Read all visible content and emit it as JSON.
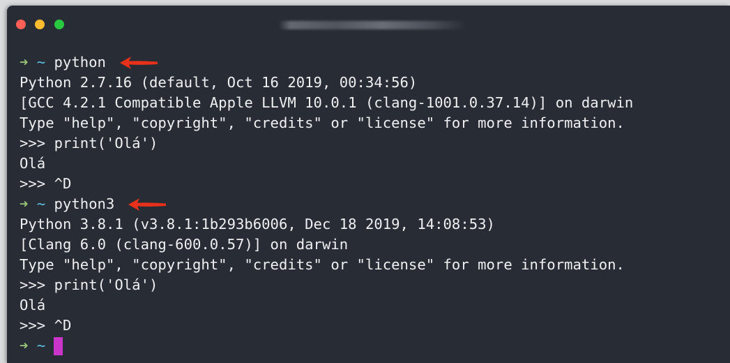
{
  "window": {
    "title": ""
  },
  "colors": {
    "background": "#282c34",
    "text": "#eef0f2",
    "prompt_arrow": "#98c379",
    "prompt_dir": "#5fc3e4",
    "cursor": "#c934c9",
    "annotation_arrow": "#e8311a"
  },
  "terminal": {
    "prompt_symbol": "➜",
    "prompt_dir": "~",
    "lines": [
      {
        "kind": "prompt",
        "command": "python",
        "annotated": true
      },
      {
        "kind": "output",
        "text": "Python 2.7.16 (default, Oct 16 2019, 00:34:56)"
      },
      {
        "kind": "output",
        "text": "[GCC 4.2.1 Compatible Apple LLVM 10.0.1 (clang-1001.0.37.14)] on darwin"
      },
      {
        "kind": "output",
        "text": "Type \"help\", \"copyright\", \"credits\" or \"license\" for more information."
      },
      {
        "kind": "output",
        "text": ">>> print('Olá')"
      },
      {
        "kind": "output",
        "text": "Olá"
      },
      {
        "kind": "output",
        "text": ">>> ^D"
      },
      {
        "kind": "prompt",
        "command": "python3",
        "annotated": true
      },
      {
        "kind": "output",
        "text": "Python 3.8.1 (v3.8.1:1b293b6006, Dec 18 2019, 14:08:53)"
      },
      {
        "kind": "output",
        "text": "[Clang 6.0 (clang-600.0.57)] on darwin"
      },
      {
        "kind": "output",
        "text": "Type \"help\", \"copyright\", \"credits\" or \"license\" for more information."
      },
      {
        "kind": "output",
        "text": ">>> print('Olá')"
      },
      {
        "kind": "output",
        "text": "Olá"
      },
      {
        "kind": "output",
        "text": ">>> ^D"
      },
      {
        "kind": "prompt",
        "command": "",
        "annotated": false,
        "cursor": true
      }
    ]
  }
}
